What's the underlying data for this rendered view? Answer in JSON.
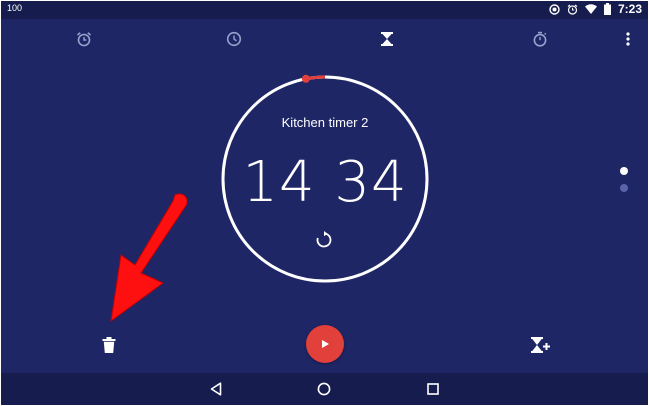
{
  "status_bar": {
    "battery_text": "100",
    "time": "7:23",
    "icons": [
      "sync-icon",
      "alarm-icon",
      "wifi-icon",
      "battery-icon"
    ]
  },
  "tabs": [
    {
      "name": "alarm",
      "icon": "alarm-icon",
      "active": false
    },
    {
      "name": "clock",
      "icon": "clock-icon",
      "active": false
    },
    {
      "name": "timer",
      "icon": "hourglass-icon",
      "active": true
    },
    {
      "name": "stopwatch",
      "icon": "stopwatch-icon",
      "active": false
    }
  ],
  "timer": {
    "label": "Kitchen timer 2",
    "time": "14 34",
    "progress": 0.03
  },
  "pager": {
    "count": 2,
    "current": 1
  },
  "actions": {
    "delete_icon": "trash-icon",
    "play_icon": "play-icon",
    "add_icon": "add-timer-icon"
  },
  "nav": {
    "back_icon": "back-icon",
    "home_icon": "home-icon",
    "recents_icon": "recents-icon"
  },
  "colors": {
    "background": "#1f2666",
    "bars": "#161c4e",
    "accent": "#e2403a",
    "annotation": "#ff1010"
  }
}
